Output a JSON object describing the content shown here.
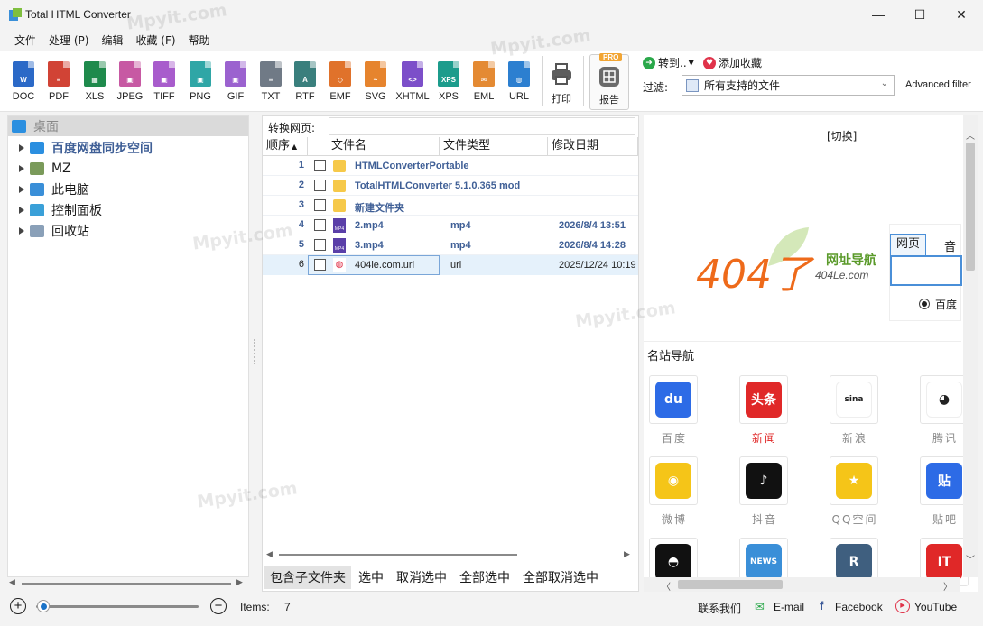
{
  "window": {
    "title": "Total HTML Converter",
    "minimize": "—",
    "maximize": "☐",
    "close": "✕"
  },
  "menu": [
    "文件",
    "处理 (P)",
    "编辑",
    "收藏 (F)",
    "帮助"
  ],
  "toolbar": {
    "formats": [
      {
        "label": "DOC",
        "color": "#2b69c7",
        "mark": "W"
      },
      {
        "label": "PDF",
        "color": "#d14335",
        "mark": "≡"
      },
      {
        "label": "XLS",
        "color": "#1f8a4c",
        "mark": "▦"
      },
      {
        "label": "JPEG",
        "color": "#c759a3",
        "mark": "▣"
      },
      {
        "label": "TIFF",
        "color": "#a85ccc",
        "mark": "▣"
      },
      {
        "label": "PNG",
        "color": "#2fa6a6",
        "mark": "▣"
      },
      {
        "label": "GIF",
        "color": "#9b62cf",
        "mark": "▣"
      },
      {
        "label": "TXT",
        "color": "#707a86",
        "mark": "≡"
      },
      {
        "label": "RTF",
        "color": "#3a7f7d",
        "mark": "A"
      },
      {
        "label": "EMF",
        "color": "#e0722b",
        "mark": "◇"
      },
      {
        "label": "SVG",
        "color": "#e6842e",
        "mark": "~"
      },
      {
        "label": "XHTML",
        "color": "#7c4fc9",
        "mark": "<>"
      },
      {
        "label": "XPS",
        "color": "#1c9c8c",
        "mark": "XPS"
      },
      {
        "label": "EML",
        "color": "#e48a33",
        "mark": "✉"
      },
      {
        "label": "URL",
        "color": "#2c7fd0",
        "mark": "◍"
      }
    ],
    "print_label": "打印",
    "report_label": "报告",
    "pro_badge": "PRO",
    "goto_label": "转到..",
    "favorite_label": "添加收藏",
    "filter_label": "过滤:",
    "filter_value": "所有支持的文件",
    "advanced_filter": "Advanced filter"
  },
  "tree": {
    "header": "桌面",
    "items": [
      {
        "label": "百度网盘同步空间",
        "bold": true,
        "color": "#2b8fe0"
      },
      {
        "label": "MZ",
        "bold": false,
        "color": "#7a9a5a"
      },
      {
        "label": "此电脑",
        "bold": false,
        "color": "#3a8fd8"
      },
      {
        "label": "控制面板",
        "bold": false,
        "color": "#3aa0d8"
      },
      {
        "label": "回收站",
        "bold": false,
        "color": "#8aa0b8"
      }
    ]
  },
  "filelist": {
    "address_label": "转换网页:",
    "columns": [
      "顺序",
      "文件名",
      "文件类型",
      "修改日期"
    ],
    "rows": [
      {
        "n": "1",
        "name": "HTMLConverterPortable",
        "type": "",
        "date": "",
        "kind": "folder"
      },
      {
        "n": "2",
        "name": "TotalHTMLConverter 5.1.0.365 mod",
        "type": "",
        "date": "",
        "kind": "folder"
      },
      {
        "n": "3",
        "name": "新建文件夹",
        "type": "",
        "date": "",
        "kind": "folder"
      },
      {
        "n": "4",
        "name": "2.mp4",
        "type": "mp4",
        "date": "2026/8/4 13:51",
        "kind": "mp4"
      },
      {
        "n": "5",
        "name": "3.mp4",
        "type": "mp4",
        "date": "2026/8/4 14:28",
        "kind": "mp4"
      },
      {
        "n": "6",
        "name": "404le.com.url",
        "type": "url",
        "date": "2025/12/24 10:19",
        "kind": "url"
      }
    ],
    "actions": [
      "包含子文件夹",
      "选中",
      "取消选中",
      "全部选中",
      "全部取消选中"
    ]
  },
  "web": {
    "switch_label": "[切换]",
    "logo_main": "404了",
    "logo_sub": "网址导航",
    "logo_domain": "404Le.com",
    "search_tabs": [
      "网页",
      "音"
    ],
    "search_engine": "百度",
    "section_title": "名站导航",
    "sites": [
      {
        "label": "百度",
        "color": "#2d6be6",
        "glyph": "du",
        "red": false
      },
      {
        "label": "新闻",
        "color": "#e02828",
        "glyph": "头条",
        "red": true
      },
      {
        "label": "新浪",
        "color": "#ffffff",
        "glyph": "sina",
        "red": false
      },
      {
        "label": "腾讯",
        "color": "#ffffff",
        "glyph": "◕",
        "red": false
      },
      {
        "label": "微博",
        "color": "#f5c518",
        "glyph": "◉",
        "red": false
      },
      {
        "label": "抖音",
        "color": "#111111",
        "glyph": "♪",
        "red": false
      },
      {
        "label": "QQ空间",
        "color": "#f5c518",
        "glyph": "★",
        "red": false
      },
      {
        "label": "贴吧",
        "color": "#2d6be6",
        "glyph": "贴",
        "red": false
      },
      {
        "label": "",
        "color": "#111111",
        "glyph": "◓",
        "red": false
      },
      {
        "label": "",
        "color": "#3a8fd8",
        "glyph": "NEWS",
        "red": false
      },
      {
        "label": "",
        "color": "#3f5f7f",
        "glyph": "R",
        "red": false
      },
      {
        "label": "",
        "color": "#e02828",
        "glyph": "IT",
        "red": false
      }
    ]
  },
  "status": {
    "items_label": "Items:",
    "items_count": "7",
    "contact": "联系我们",
    "email": "E-mail",
    "facebook": "Facebook",
    "youtube": "YouTube"
  },
  "watermark": "Mpyit.com"
}
